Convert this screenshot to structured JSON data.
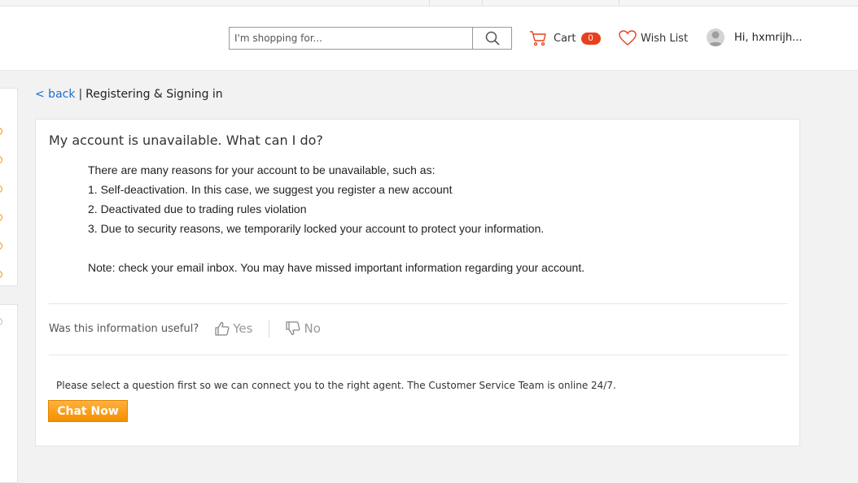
{
  "header": {
    "search": {
      "placeholder": "I'm shopping for..."
    },
    "cart": {
      "label": "Cart",
      "count": "0"
    },
    "wishlist": {
      "label": "Wish List"
    },
    "user": {
      "greeting": "Hi, hxmrijh..."
    }
  },
  "breadcrumb": {
    "back": "< back",
    "separator": "|",
    "current": "Registering & Signing in"
  },
  "article": {
    "title": "My account is unavailable. What can I do?",
    "lines": [
      "There are many reasons for your account to be unavailable, such as:",
      "1. Self-deactivation. In this case, we suggest you register a new account",
      "2. Deactivated due to trading rules violation",
      "3. Due to security reasons, we temporarily locked your account to protect your information."
    ],
    "note": "Note: check your email inbox. You may have missed important information regarding your account."
  },
  "feedback": {
    "question": "Was this information useful?",
    "yes": "Yes",
    "no": "No"
  },
  "support": {
    "notice": "Please select a question first so we can connect you to the right agent. The Customer Service Team is online 24/7.",
    "chat_button": "Chat Now"
  },
  "colors": {
    "accent": "#f58f00",
    "link": "#1a6fd0",
    "badge": "#e8401c"
  }
}
